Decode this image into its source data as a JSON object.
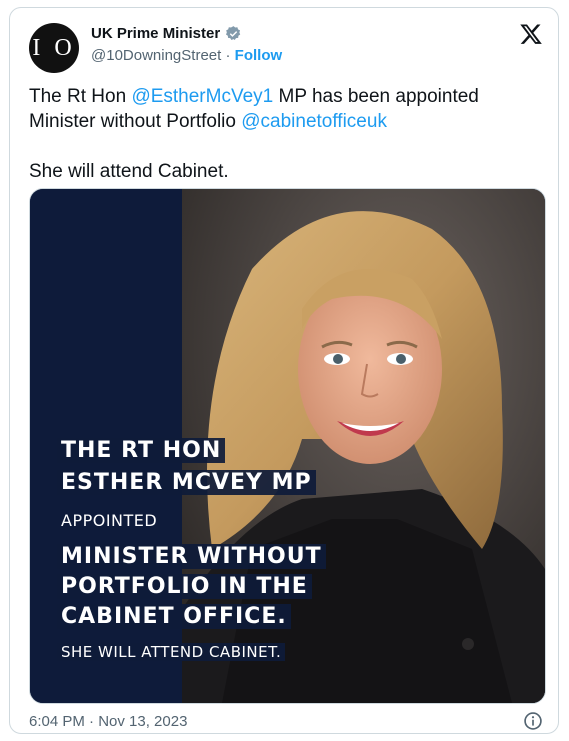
{
  "author": {
    "avatar_text": "I O",
    "display_name": "UK Prime Minister",
    "handle": "@10DowningStreet",
    "separator": " · ",
    "follow_label": "Follow"
  },
  "tweet": {
    "line1_pre": "The Rt Hon ",
    "mention1": "@EstherMcVey1",
    "line1_post": " MP has been appointed",
    "line2_pre": "Minister without Portfolio ",
    "mention2": "@cabinetofficeuk",
    "line3": "She will attend Cabinet."
  },
  "media": {
    "line1": "THE RT HON",
    "line2": "ESTHER MCVEY MP",
    "line3": "APPOINTED",
    "line4": "MINISTER WITHOUT",
    "line5": "PORTFOLIO IN THE",
    "line6": "CABINET OFFICE.",
    "line7": "SHE WILL ATTEND CABINET."
  },
  "meta": {
    "timestamp": "6:04 PM · Nov 13, 2023"
  },
  "colors": {
    "link": "#1d9bf0",
    "navy": "#0e1b3a",
    "muted": "#536471"
  },
  "icons": {
    "verified": "verified-badge-icon",
    "x_logo": "x-logo-icon",
    "info": "info-icon"
  }
}
